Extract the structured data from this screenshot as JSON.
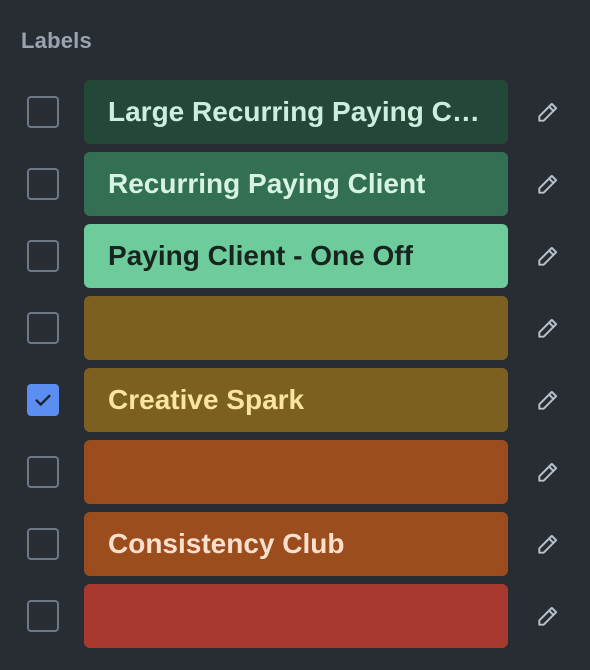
{
  "panel": {
    "title": "Labels"
  },
  "labels": [
    {
      "name": "Large Recurring Paying Cli...",
      "checked": false,
      "color": "#234838",
      "text_color": "#cdeede"
    },
    {
      "name": "Recurring Paying Client",
      "checked": false,
      "color": "#336f53",
      "text_color": "#d6f3e4"
    },
    {
      "name": "Paying Client - One Off",
      "checked": false,
      "color": "#6ecb9b",
      "text_color": "#17251e"
    },
    {
      "name": "",
      "checked": false,
      "color": "#7b6020",
      "text_color": "#fbe3a0"
    },
    {
      "name": "Creative Spark",
      "checked": true,
      "color": "#7b6020",
      "text_color": "#fbe3a0"
    },
    {
      "name": "",
      "checked": false,
      "color": "#9b4d1e",
      "text_color": "#fde0cc"
    },
    {
      "name": "Consistency Club",
      "checked": false,
      "color": "#9b4d1e",
      "text_color": "#fde0cc"
    },
    {
      "name": "",
      "checked": false,
      "color": "#a8392e",
      "text_color": "#fdd8d2"
    }
  ],
  "icons": {
    "edit": "pencil-icon",
    "check": "checkmark-icon"
  },
  "colors": {
    "background": "#282d33",
    "heading": "#9aa4b0",
    "checkbox_border": "#6e7885",
    "checkbox_checked": "#5b8ef0",
    "edit_icon": "#b8c0ca"
  }
}
